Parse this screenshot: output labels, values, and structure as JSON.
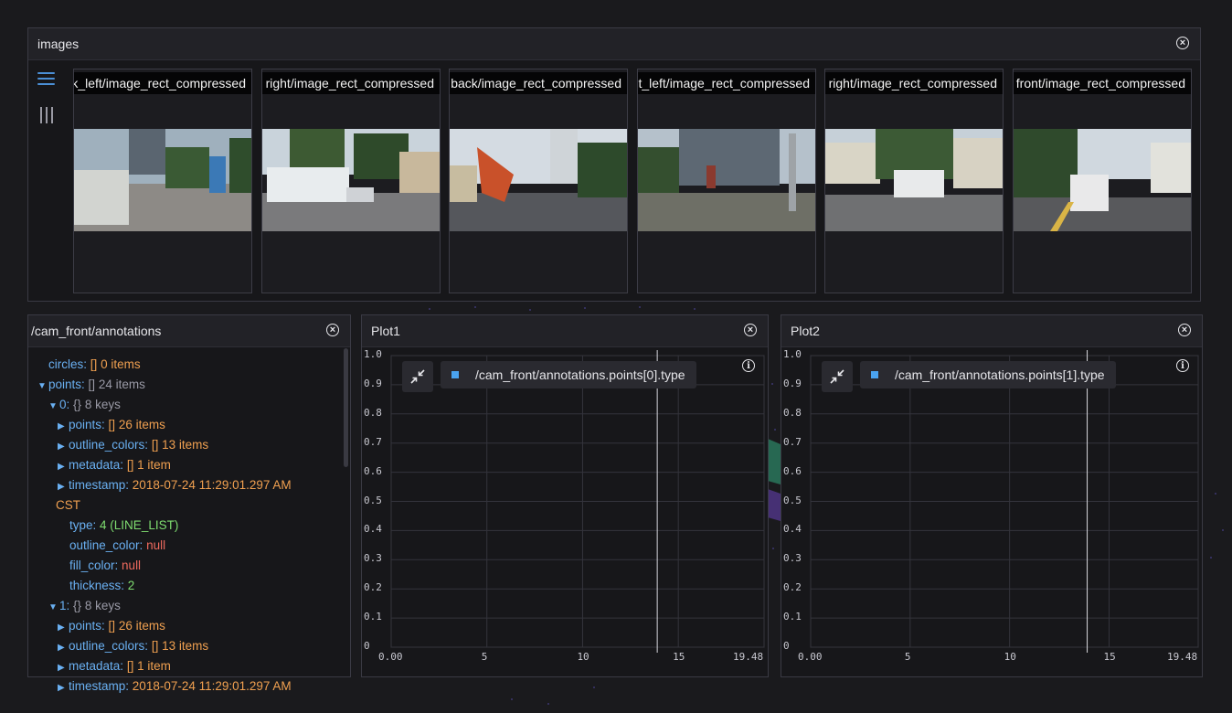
{
  "images_panel": {
    "title": "images",
    "tiles": [
      {
        "label": "k_left/image_rect_compressed"
      },
      {
        "label": "right/image_rect_compressed"
      },
      {
        "label": "back/image_rect_compressed"
      },
      {
        "label": "t_left/image_rect_compressed"
      },
      {
        "label": "right/image_rect_compressed"
      },
      {
        "label": "front/image_rect_compressed"
      }
    ]
  },
  "annotations_panel": {
    "title": "/cam_front/annotations",
    "rows": [
      {
        "indent": 0,
        "toggle": "",
        "key": "circles:",
        "meta": "[]",
        "value": "0 items",
        "vclass": "arr"
      },
      {
        "indent": 0,
        "toggle": "▼",
        "key": "points:",
        "meta": "[]",
        "value": "24 items",
        "vclass": "meta"
      },
      {
        "indent": 1,
        "toggle": "▼",
        "key": "0:",
        "meta": "{}",
        "value": "8 keys",
        "vclass": "meta"
      },
      {
        "indent": 2,
        "toggle": "▶",
        "key": "points:",
        "meta": "[]",
        "value": "26 items",
        "vclass": "arr"
      },
      {
        "indent": 2,
        "toggle": "▶",
        "key": "outline_colors:",
        "meta": "[]",
        "value": "13 items",
        "vclass": "arr"
      },
      {
        "indent": 2,
        "toggle": "▶",
        "key": "metadata:",
        "meta": "[]",
        "value": "1 item",
        "vclass": "arr"
      },
      {
        "indent": 2,
        "toggle": "▶",
        "key": "timestamp:",
        "meta": "",
        "value": "2018-07-24 11:29:01.297 AM",
        "vclass": "arr"
      },
      {
        "indent": -1,
        "toggle": "",
        "key": "",
        "meta": "",
        "value": "CST",
        "vclass": "arr"
      },
      {
        "indent": 2,
        "toggle": "",
        "key": "type:",
        "meta": "",
        "value": "4 (LINE_LIST)",
        "vclass": "green"
      },
      {
        "indent": 2,
        "toggle": "",
        "key": "outline_color:",
        "meta": "",
        "value": "null",
        "vclass": "red"
      },
      {
        "indent": 2,
        "toggle": "",
        "key": "fill_color:",
        "meta": "",
        "value": "null",
        "vclass": "red"
      },
      {
        "indent": 2,
        "toggle": "",
        "key": "thickness:",
        "meta": "",
        "value": "2",
        "vclass": "green"
      },
      {
        "indent": 1,
        "toggle": "▼",
        "key": "1:",
        "meta": "{}",
        "value": "8 keys",
        "vclass": "meta"
      },
      {
        "indent": 2,
        "toggle": "▶",
        "key": "points:",
        "meta": "[]",
        "value": "26 items",
        "vclass": "arr"
      },
      {
        "indent": 2,
        "toggle": "▶",
        "key": "outline_colors:",
        "meta": "[]",
        "value": "13 items",
        "vclass": "arr"
      },
      {
        "indent": 2,
        "toggle": "▶",
        "key": "metadata:",
        "meta": "[]",
        "value": "1 item",
        "vclass": "arr"
      },
      {
        "indent": 2,
        "toggle": "▶",
        "key": "timestamp:",
        "meta": "",
        "value": "2018-07-24 11:29:01.297 AM",
        "vclass": "arr"
      }
    ]
  },
  "plots": [
    {
      "title": "Plot1",
      "legend": "/cam_front/annotations.points[0].type",
      "y_ticks": [
        "1.0",
        "0.9",
        "0.8",
        "0.7",
        "0.6",
        "0.5",
        "0.4",
        "0.3",
        "0.2",
        "0.1",
        "0"
      ],
      "x_ticks": [
        "0.00",
        "5",
        "10",
        "15",
        "19.48"
      ],
      "cursor_x": 13.9
    },
    {
      "title": "Plot2",
      "legend": "/cam_front/annotations.points[1].type",
      "y_ticks": [
        "1.0",
        "0.9",
        "0.8",
        "0.7",
        "0.6",
        "0.5",
        "0.4",
        "0.3",
        "0.2",
        "0.1",
        "0"
      ],
      "x_ticks": [
        "0.00",
        "5",
        "10",
        "15",
        "19.48"
      ],
      "cursor_x": 13.9
    }
  ],
  "chart_data": [
    {
      "type": "line",
      "title": "Plot1",
      "series": [
        {
          "name": "/cam_front/annotations.points[0].type",
          "x": [],
          "y": []
        }
      ],
      "xlim": [
        0,
        19.48
      ],
      "ylim": [
        0,
        1.0
      ],
      "grid": true,
      "legend": "top-left"
    },
    {
      "type": "line",
      "title": "Plot2",
      "series": [
        {
          "name": "/cam_front/annotations.points[1].type",
          "x": [],
          "y": []
        }
      ],
      "xlim": [
        0,
        19.48
      ],
      "ylim": [
        0,
        1.0
      ],
      "grid": true,
      "legend": "top-left"
    }
  ],
  "colors": {
    "accent": "#4b8fd6",
    "key": "#6ab0f2",
    "array": "#f0a050",
    "number": "#7fdd70",
    "null": "#ef6a5e"
  },
  "icons": {
    "panel_close": "close-circle-icon",
    "menu": "hamburger-icon",
    "layout": "columns-icon",
    "collapse": "collapse-arrows-icon",
    "info": "info-icon"
  }
}
